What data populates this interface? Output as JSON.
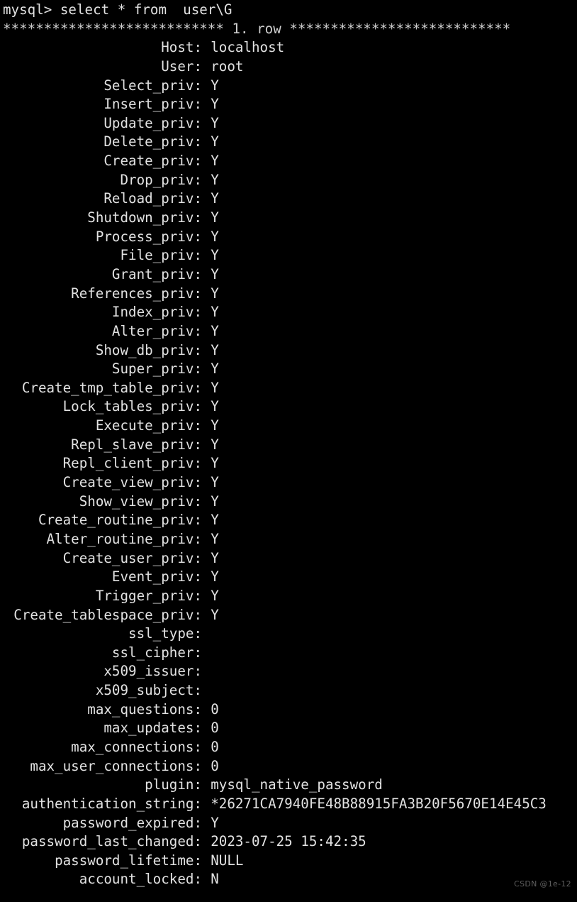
{
  "terminal": {
    "background_color": "#000000",
    "text_color": "#d6d6d6",
    "prompt_line": "mysql> select * from  user\\G",
    "separator_line": "*************************** 1. row ***************************",
    "watermark": "CSDN @1e-12",
    "rows": [
      {
        "label": "Host",
        "value": "localhost"
      },
      {
        "label": "User",
        "value": "root"
      },
      {
        "label": "Select_priv",
        "value": "Y"
      },
      {
        "label": "Insert_priv",
        "value": "Y"
      },
      {
        "label": "Update_priv",
        "value": "Y"
      },
      {
        "label": "Delete_priv",
        "value": "Y"
      },
      {
        "label": "Create_priv",
        "value": "Y"
      },
      {
        "label": "Drop_priv",
        "value": "Y"
      },
      {
        "label": "Reload_priv",
        "value": "Y"
      },
      {
        "label": "Shutdown_priv",
        "value": "Y"
      },
      {
        "label": "Process_priv",
        "value": "Y"
      },
      {
        "label": "File_priv",
        "value": "Y"
      },
      {
        "label": "Grant_priv",
        "value": "Y"
      },
      {
        "label": "References_priv",
        "value": "Y"
      },
      {
        "label": "Index_priv",
        "value": "Y"
      },
      {
        "label": "Alter_priv",
        "value": "Y"
      },
      {
        "label": "Show_db_priv",
        "value": "Y"
      },
      {
        "label": "Super_priv",
        "value": "Y"
      },
      {
        "label": "Create_tmp_table_priv",
        "value": "Y"
      },
      {
        "label": "Lock_tables_priv",
        "value": "Y"
      },
      {
        "label": "Execute_priv",
        "value": "Y"
      },
      {
        "label": "Repl_slave_priv",
        "value": "Y"
      },
      {
        "label": "Repl_client_priv",
        "value": "Y"
      },
      {
        "label": "Create_view_priv",
        "value": "Y"
      },
      {
        "label": "Show_view_priv",
        "value": "Y"
      },
      {
        "label": "Create_routine_priv",
        "value": "Y"
      },
      {
        "label": "Alter_routine_priv",
        "value": "Y"
      },
      {
        "label": "Create_user_priv",
        "value": "Y"
      },
      {
        "label": "Event_priv",
        "value": "Y"
      },
      {
        "label": "Trigger_priv",
        "value": "Y"
      },
      {
        "label": "Create_tablespace_priv",
        "value": "Y"
      },
      {
        "label": "ssl_type",
        "value": ""
      },
      {
        "label": "ssl_cipher",
        "value": ""
      },
      {
        "label": "x509_issuer",
        "value": ""
      },
      {
        "label": "x509_subject",
        "value": ""
      },
      {
        "label": "max_questions",
        "value": "0"
      },
      {
        "label": "max_updates",
        "value": "0"
      },
      {
        "label": "max_connections",
        "value": "0"
      },
      {
        "label": "max_user_connections",
        "value": "0"
      },
      {
        "label": "plugin",
        "value": "mysql_native_password"
      },
      {
        "label": "authentication_string",
        "value": "*26271CA7940FE48B88915FA3B20F5670E14E45C3"
      },
      {
        "label": "password_expired",
        "value": "Y"
      },
      {
        "label": "password_last_changed",
        "value": "2023-07-25 15:42:35"
      },
      {
        "label": "password_lifetime",
        "value": "NULL"
      },
      {
        "label": "account_locked",
        "value": "N"
      }
    ]
  }
}
